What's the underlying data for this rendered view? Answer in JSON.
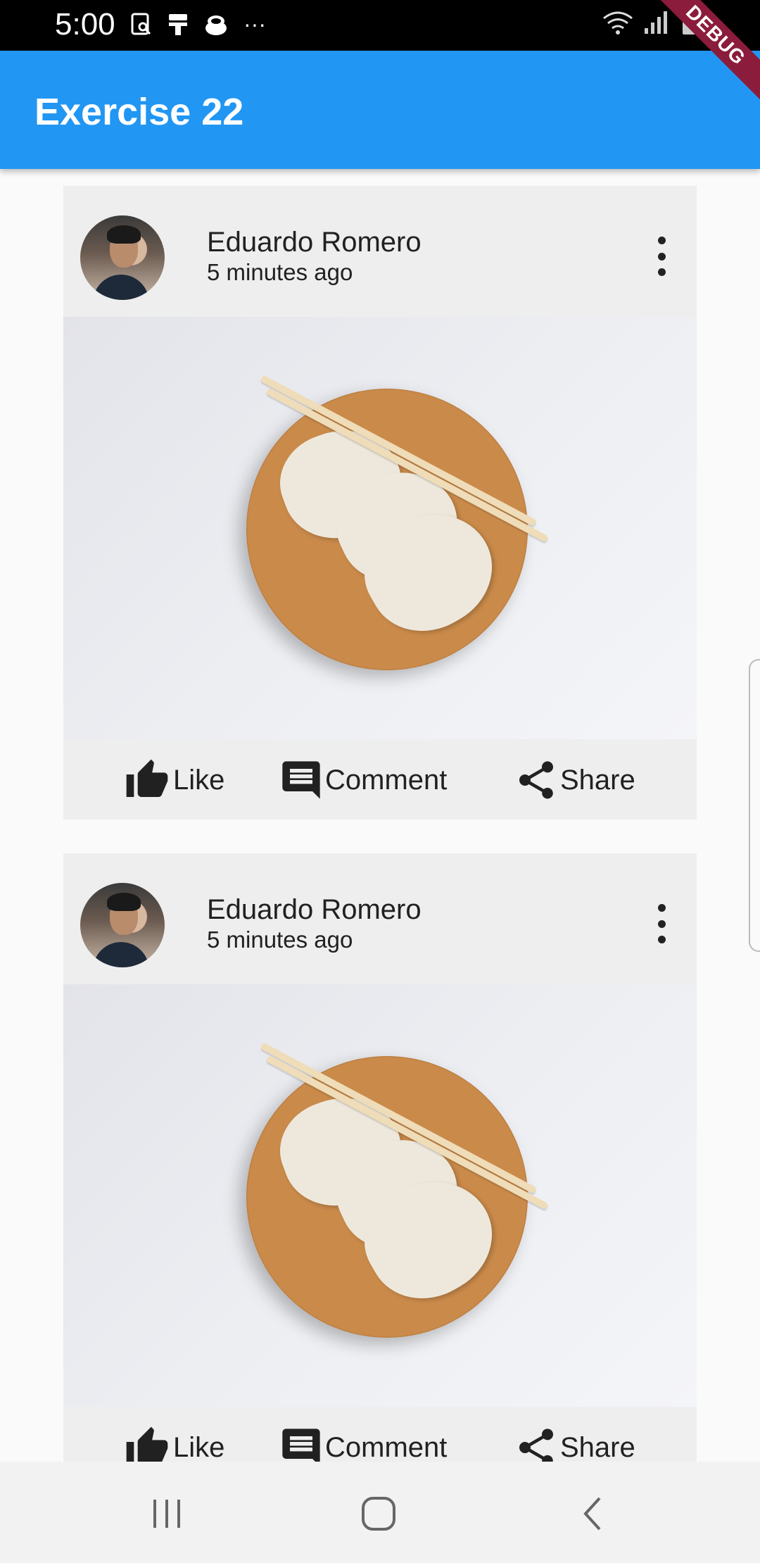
{
  "status_bar": {
    "time": "5:00",
    "more": "···",
    "icons_left": [
      "screenshot-icon",
      "paint-roller-icon",
      "coffee-icon"
    ],
    "icons_right": [
      "wifi-icon",
      "signal-icon",
      "battery-icon"
    ],
    "debug_label": "DEBUG"
  },
  "app_bar": {
    "title": "Exercise 22",
    "color": "#2196f3"
  },
  "posts": [
    {
      "author": "Eduardo Romero",
      "time": "5 minutes ago",
      "image": "dumplings-on-wooden-plate",
      "actions": {
        "like": "Like",
        "comment": "Comment",
        "share": "Share"
      }
    },
    {
      "author": "Eduardo Romero",
      "time": "5 minutes ago",
      "image": "dumplings-on-wooden-plate",
      "actions": {
        "like": "Like",
        "comment": "Comment",
        "share": "Share"
      }
    }
  ],
  "nav_bar": {
    "icons": [
      "recent-apps-icon",
      "home-icon",
      "back-icon"
    ]
  }
}
